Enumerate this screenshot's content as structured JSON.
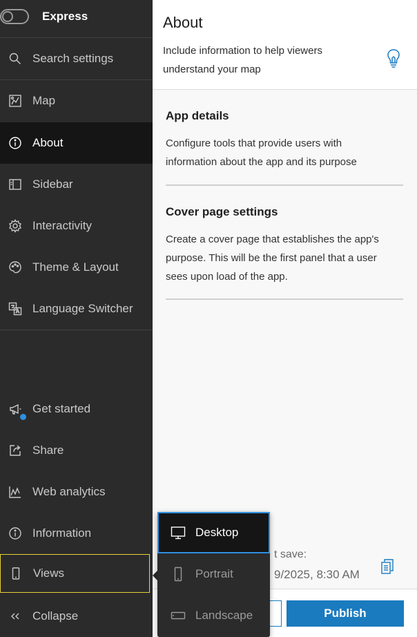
{
  "sidebar": {
    "express_label": "Express",
    "items": [
      {
        "label": "Search settings",
        "icon": "search-icon"
      },
      {
        "label": "Map",
        "icon": "map-icon"
      },
      {
        "label": "About",
        "icon": "info-icon"
      },
      {
        "label": "Sidebar",
        "icon": "sidebar-icon"
      },
      {
        "label": "Interactivity",
        "icon": "gear-icon"
      },
      {
        "label": "Theme & Layout",
        "icon": "palette-icon"
      },
      {
        "label": "Language Switcher",
        "icon": "language-icon"
      }
    ],
    "bottom_items": [
      {
        "label": "Get started",
        "icon": "megaphone-icon"
      },
      {
        "label": "Share",
        "icon": "share-icon"
      },
      {
        "label": "Web analytics",
        "icon": "analytics-icon"
      },
      {
        "label": "Information",
        "icon": "info-icon"
      },
      {
        "label": "Views",
        "icon": "mobile-icon"
      },
      {
        "label": "Collapse",
        "icon": "chevrons-left-icon"
      }
    ]
  },
  "about": {
    "title": "About",
    "description": "Include information to help viewers understand your map"
  },
  "sections": [
    {
      "title": "App details",
      "description": "Configure tools that provide users with information about the app and its purpose"
    },
    {
      "title": "Cover page settings",
      "description": "Create a cover page that establishes the app's purpose. This will be the first panel that a user sees upon load of the app."
    }
  ],
  "save": {
    "label_fragment": "t save:",
    "value_fragment": "9/2025, 8:30 AM"
  },
  "footer": {
    "publish_label": "Publish"
  },
  "views_menu": {
    "items": [
      {
        "label": "Desktop",
        "icon": "desktop-icon",
        "selected": true
      },
      {
        "label": "Portrait",
        "icon": "portrait-icon",
        "selected": false
      },
      {
        "label": "Landscape",
        "icon": "landscape-icon",
        "selected": false
      }
    ]
  },
  "colors": {
    "sidebar_bg": "#2b2b2b",
    "active_bg": "#151515",
    "accent": "#1a7bbf",
    "focus_outline": "#e6d23a",
    "notification_dot": "#2f8fe0"
  }
}
